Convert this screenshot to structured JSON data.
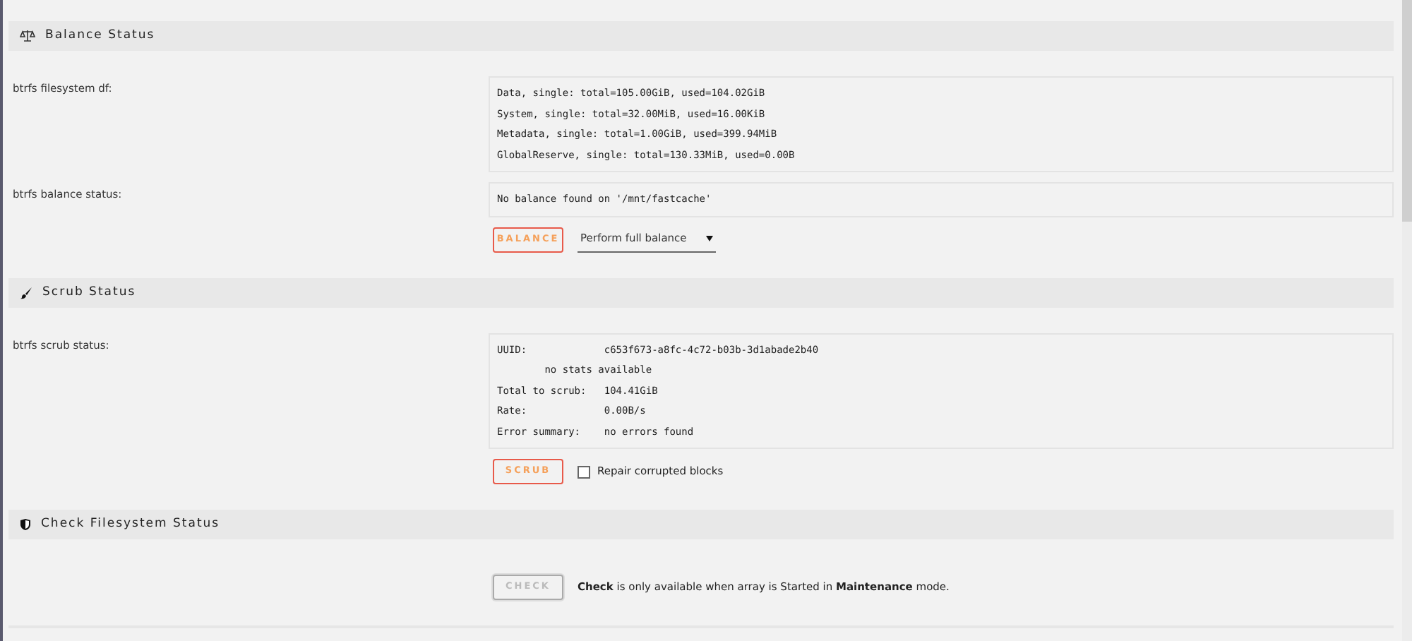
{
  "sections": [
    {
      "kind": "balance",
      "title": "Balance Status",
      "fields": [
        {
          "label": "btrfs filesystem df:",
          "lines": [
            "Data, single: total=105.00GiB, used=104.02GiB",
            "System, single: total=32.00MiB, used=16.00KiB",
            "Metadata, single: total=1.00GiB, used=399.94MiB",
            "GlobalReserve, single: total=130.33MiB, used=0.00B"
          ]
        },
        {
          "label": "btrfs balance status:",
          "lines": [
            "No balance found on '/mnt/fastcache'"
          ]
        }
      ],
      "button": {
        "label": "BALANCE",
        "disabled": false
      },
      "select": {
        "value": "Perform full balance"
      }
    },
    {
      "kind": "scrub",
      "title": "Scrub Status",
      "fields": [
        {
          "label": "btrfs scrub status:",
          "lines": [
            "UUID:             c653f673-a8fc-4c72-b03b-3d1abade2b40",
            "        no stats available",
            "Total to scrub:   104.41GiB",
            "Rate:             0.00B/s",
            "Error summary:    no errors found"
          ]
        }
      ],
      "button": {
        "label": "SCRUB",
        "disabled": false
      },
      "checkbox": {
        "label": "Repair corrupted blocks",
        "checked": false
      }
    },
    {
      "kind": "check",
      "title": "Check Filesystem Status",
      "button": {
        "label": "CHECK",
        "disabled": true
      },
      "note": "**Check** is only available when array is Started in **Maintenance** mode."
    }
  ]
}
